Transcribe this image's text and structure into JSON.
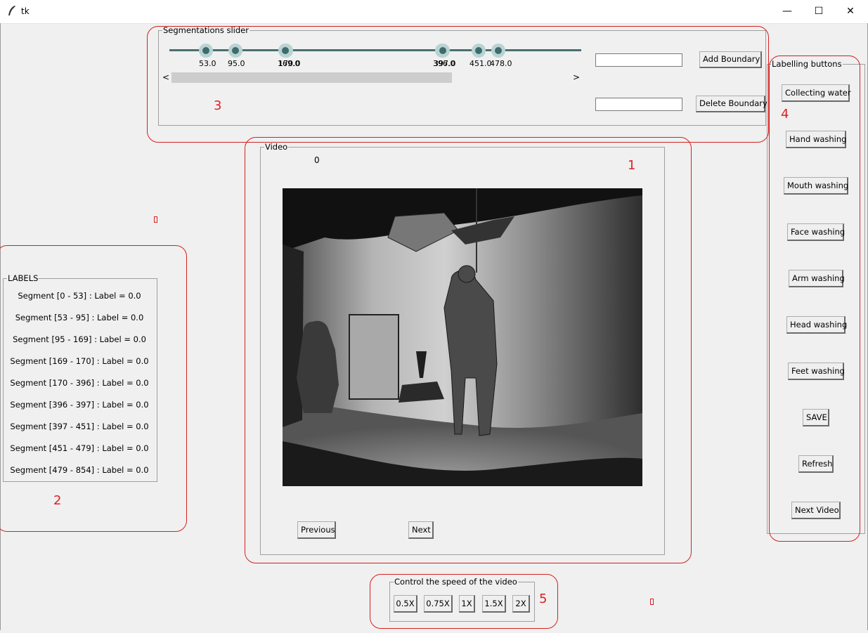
{
  "window": {
    "title": "tk",
    "controls": {
      "minimize": "—",
      "maximize": "☐",
      "close": "✕"
    }
  },
  "segmentation": {
    "frame_label": "Segmentations slider",
    "ticks": [
      "53.0",
      "95.0",
      "169.0",
      "170.0",
      "396.0",
      "397.0",
      "451.0",
      "478.0"
    ],
    "scroll_left": "<",
    "scroll_right": ">",
    "add_boundary_value": "",
    "delete_boundary_value": "",
    "add_boundary_label": "Add Boundary",
    "delete_boundary_label": "Delete Boundary"
  },
  "video": {
    "frame_label": "Video",
    "frame_counter": "0",
    "previous_label": "Previous",
    "next_label": "Next"
  },
  "labels": {
    "frame_label": "LABELS",
    "segments": [
      "Segment [0 - 53] : Label = 0.0",
      "Segment [53 - 95] : Label = 0.0",
      "Segment [95 - 169] : Label = 0.0",
      "Segment [169 - 170] : Label = 0.0",
      "Segment [170 - 396] : Label = 0.0",
      "Segment [396 - 397] : Label = 0.0",
      "Segment [397 - 451] : Label = 0.0",
      "Segment [451 - 479] : Label = 0.0",
      "Segment [479 - 854] : Label = 0.0"
    ]
  },
  "labelling": {
    "frame_label": "Labelling buttons",
    "buttons": [
      "Collecting water",
      "Hand washing",
      "Mouth washing",
      "Face washing",
      "Arm washing",
      "Head washing",
      "Feet washing",
      "SAVE",
      "Refresh",
      "Next Video"
    ]
  },
  "speed": {
    "frame_label": "Control the speed of the video",
    "buttons": [
      "0.5X",
      "0.75X",
      "1X",
      "1.5X",
      "2X"
    ]
  },
  "annotations": [
    "1",
    "2",
    "3",
    "4",
    "5"
  ],
  "colors": {
    "annotation": "#d62020",
    "slider_track": "#4a6f6f",
    "slider_knob": "#3e6b6b"
  }
}
